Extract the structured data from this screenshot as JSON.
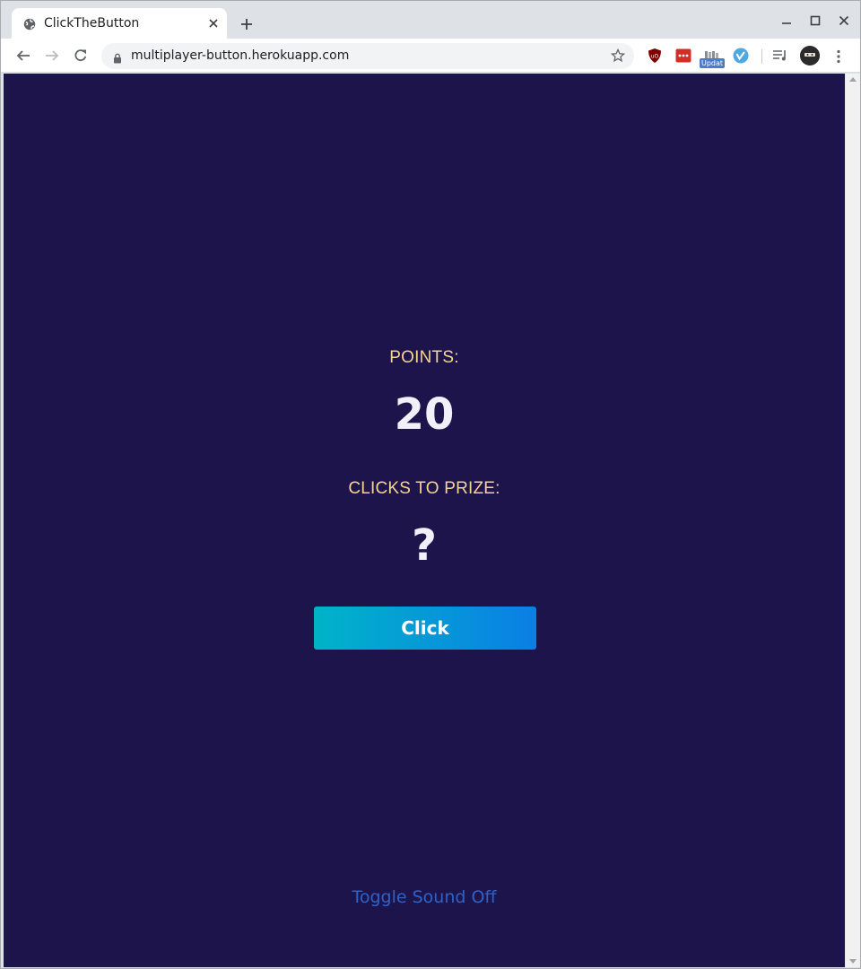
{
  "browser": {
    "tab_title": "ClickTheButton",
    "url": "multiplayer-button.herokuapp.com",
    "extension_badge": "Updat"
  },
  "game": {
    "points_label": "POINTS:",
    "points_value": "20",
    "clicks_label": "CLICKS TO PRIZE:",
    "clicks_value": "?",
    "button_label": "Click",
    "toggle_sound_label": "Toggle Sound Off"
  },
  "colors": {
    "page_background": "#1d144b",
    "label_color": "#f6d58e",
    "value_color": "#f1eff8",
    "button_gradient_start": "#00b4c8",
    "button_gradient_end": "#0a7fe6",
    "toggle_link_color": "#2f62c6"
  },
  "icons": {
    "tab_favicon": "globe-icon",
    "tab_close": "close-icon",
    "new_tab": "plus-icon",
    "back": "back-arrow-icon",
    "forward": "forward-arrow-icon",
    "reload": "reload-icon",
    "lock": "lock-icon",
    "bookmark": "star-icon",
    "menu": "kebab-menu-icon"
  }
}
